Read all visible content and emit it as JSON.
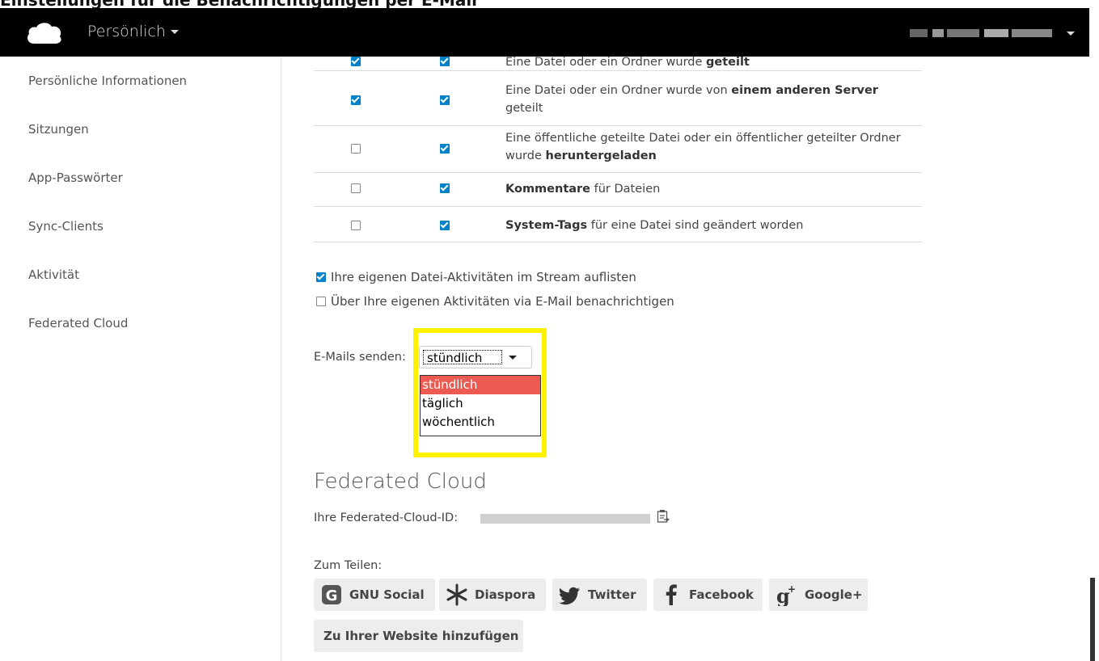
{
  "header": {
    "top_strip_text": "Einstellungen für die Benachrichtigungen per E-Mail",
    "app_menu_label": "Persönlich"
  },
  "sidebar": {
    "items": [
      {
        "label": "Persönliche Informationen"
      },
      {
        "label": "Sitzungen"
      },
      {
        "label": "App-Passwörter"
      },
      {
        "label": "Sync-Clients"
      },
      {
        "label": "Aktivität"
      },
      {
        "label": "Federated Cloud"
      }
    ]
  },
  "activity": {
    "rows": [
      {
        "mail": true,
        "stream": true,
        "pre": "Eine Datei oder ein Ordner wurde ",
        "bold": "geteilt",
        "post": ""
      },
      {
        "mail": true,
        "stream": true,
        "pre": "Eine Datei oder ein Ordner wurde von ",
        "bold": "einem anderen Server",
        "post": " geteilt"
      },
      {
        "mail": false,
        "stream": true,
        "pre": "Eine öffentliche geteilte Datei oder ein öffentlicher geteilter Ordner wurde ",
        "bold": "heruntergeladen",
        "post": ""
      },
      {
        "mail": false,
        "stream": true,
        "pre": "",
        "bold": "Kommentare",
        "post": " für Dateien"
      },
      {
        "mail": false,
        "stream": true,
        "pre": "",
        "bold": "System-Tags",
        "post": " für eine Datei sind geändert worden"
      }
    ],
    "options": [
      {
        "checked": true,
        "label": "Ihre eigenen Datei-Aktivitäten im Stream auflisten"
      },
      {
        "checked": false,
        "label": "Über Ihre eigenen Aktivitäten via E-Mail benachrichtigen"
      }
    ],
    "email_label": "E-Mails senden:",
    "select_value": "stündlich",
    "select_options": [
      "stündlich",
      "täglich",
      "wöchentlich"
    ]
  },
  "federated": {
    "title": "Federated Cloud",
    "id_label": "Ihre Federated-Cloud-ID:",
    "share_label": "Zum Teilen:",
    "buttons": [
      {
        "label": "GNU Social",
        "icon": "gnu-social-icon"
      },
      {
        "label": "Diaspora",
        "icon": "diaspora-icon"
      },
      {
        "label": "Twitter",
        "icon": "twitter-icon"
      },
      {
        "label": "Facebook",
        "icon": "facebook-icon"
      },
      {
        "label": "Google+",
        "icon": "google-plus-icon"
      }
    ],
    "website_button": "Zu Ihrer Website hinzufügen"
  },
  "colors": {
    "header_bg": "#000000",
    "checkbox_blue": "#0082c9",
    "dropdown_selected": "#ed5a52",
    "highlight": "#fff200"
  }
}
